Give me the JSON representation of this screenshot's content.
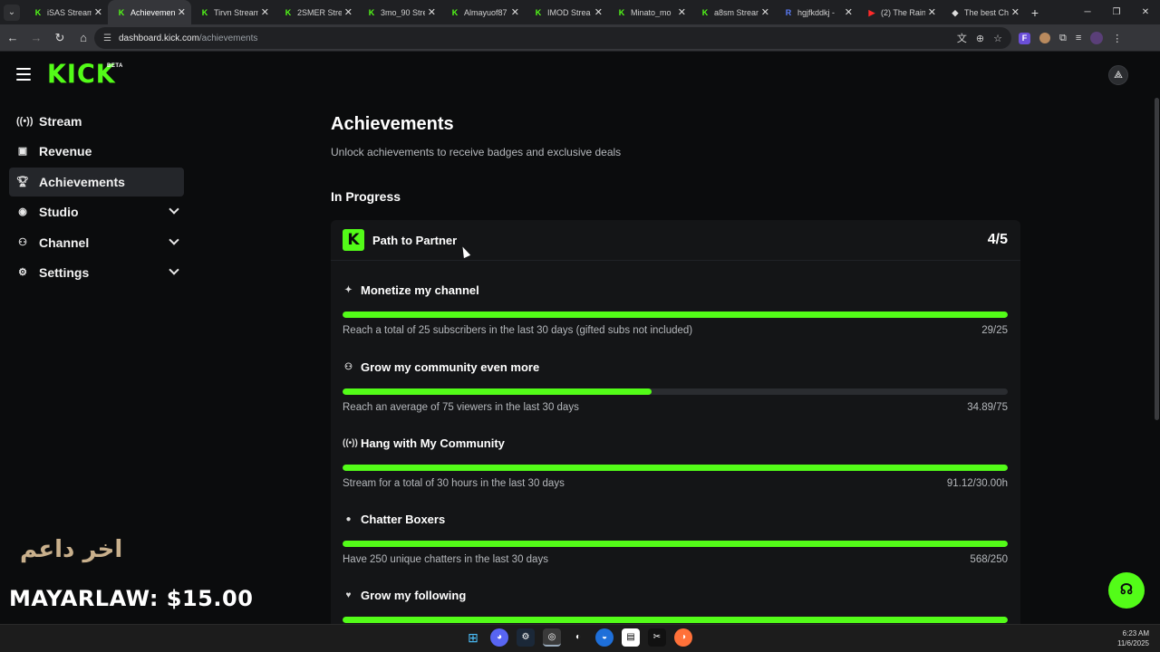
{
  "browser": {
    "tabs": [
      {
        "label": "iSAS Stream"
      },
      {
        "label": "Achievements"
      },
      {
        "label": "Tirvn Stream"
      },
      {
        "label": "2SMER Strea"
      },
      {
        "label": "3mo_90 Stre"
      },
      {
        "label": "Almayuof87"
      },
      {
        "label": "IMOD Strea"
      },
      {
        "label": "Minato_mo"
      },
      {
        "label": "a8sm Stream"
      },
      {
        "label": "hgjfkddkj -"
      },
      {
        "label": "(2) The Rain"
      },
      {
        "label": "The best Ch"
      }
    ],
    "url_host": "dashboard.kick.com",
    "url_path": "/achievements"
  },
  "header": {
    "logo": "KICK",
    "beta": "BETA"
  },
  "sidebar": {
    "items": [
      {
        "label": "Stream",
        "icon": "broadcast-icon"
      },
      {
        "label": "Revenue",
        "icon": "chart-icon"
      },
      {
        "label": "Achievements",
        "icon": "trophy-icon"
      },
      {
        "label": "Studio",
        "icon": "camera-icon"
      },
      {
        "label": "Channel",
        "icon": "users-icon"
      },
      {
        "label": "Settings",
        "icon": "gear-icon"
      }
    ]
  },
  "overlay": {
    "arabic": "اخر داعم",
    "donor": "MAYARLAW: $15.00"
  },
  "main": {
    "title": "Achievements",
    "subtitle": "Unlock achievements to receive badges and exclusive deals",
    "section": "In Progress",
    "card": {
      "title": "Path to Partner",
      "count": "4/5",
      "achievements": [
        {
          "title": "Monetize my channel",
          "icon": "sparkle-icon",
          "description": "Reach a total of 25 subscribers in the last 30 days (gifted subs not included)",
          "progress": "29/25",
          "fill": 1.0
        },
        {
          "title": "Grow my community even more",
          "icon": "user-plus-icon",
          "description": "Reach an average of 75 viewers in the last 30 days",
          "progress": "34.89/75",
          "fill": 0.465
        },
        {
          "title": "Hang with My Community",
          "icon": "broadcast-icon",
          "description": "Stream for a total of 30 hours in the last 30 days",
          "progress": "91.12/30.00h",
          "fill": 1.0
        },
        {
          "title": "Chatter Boxers",
          "icon": "chat-icon",
          "description": "Have 250 unique chatters in the last 30 days",
          "progress": "568/250",
          "fill": 1.0
        },
        {
          "title": "Grow my following",
          "icon": "heart-icon",
          "description": "",
          "progress": "",
          "fill": 1.0
        }
      ]
    }
  },
  "taskbar": {
    "time": "6:23 AM",
    "date": "11/6/2025"
  },
  "colors": {
    "accent": "#53fc18",
    "background": "#0b0c0d",
    "card": "#141517"
  }
}
